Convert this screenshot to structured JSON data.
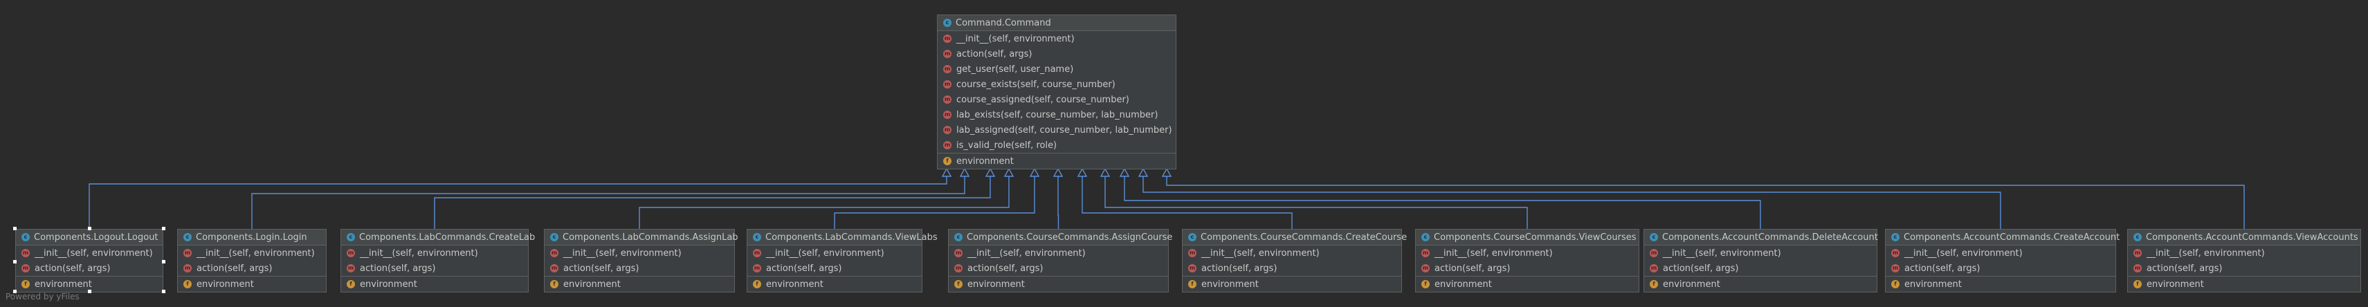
{
  "parent": {
    "name": "Command.Command",
    "icon": "class-icon",
    "methods": [
      "__init__(self, environment)",
      "action(self, args)",
      "get_user(self, user_name)",
      "course_exists(self, course_number)",
      "course_assigned(self, course_number)",
      "lab_exists(self, course_number, lab_number)",
      "lab_assigned(self, course_number, lab_number)",
      "is_valid_role(self, role)"
    ],
    "fields": [
      "environment"
    ]
  },
  "children": [
    {
      "name": "Components.Logout.Logout",
      "methods": [
        "__init__(self, environment)",
        "action(self, args)"
      ],
      "fields": [
        "environment"
      ]
    },
    {
      "name": "Components.Login.Login",
      "methods": [
        "__init__(self, environment)",
        "action(self, args)"
      ],
      "fields": [
        "environment"
      ]
    },
    {
      "name": "Components.LabCommands.CreateLab",
      "methods": [
        "__init__(self, environment)",
        "action(self, args)"
      ],
      "fields": [
        "environment"
      ]
    },
    {
      "name": "Components.LabCommands.AssignLab",
      "methods": [
        "__init__(self, environment)",
        "action(self, args)"
      ],
      "fields": [
        "environment"
      ]
    },
    {
      "name": "Components.LabCommands.ViewLabs",
      "methods": [
        "__init__(self, environment)",
        "action(self, args)"
      ],
      "fields": [
        "environment"
      ]
    },
    {
      "name": "Components.CourseCommands.AssignCourse",
      "methods": [
        "__init__(self, environment)",
        "action(self, args)"
      ],
      "fields": [
        "environment"
      ]
    },
    {
      "name": "Components.CourseCommands.CreateCourse",
      "methods": [
        "__init__(self, environment)",
        "action(self, args)"
      ],
      "fields": [
        "environment"
      ]
    },
    {
      "name": "Components.CourseCommands.ViewCourses",
      "methods": [
        "__init__(self, environment)",
        "action(self, args)"
      ],
      "fields": [
        "environment"
      ]
    },
    {
      "name": "Components.AccountCommands.DeleteAccount",
      "methods": [
        "__init__(self, environment)",
        "action(self, args)"
      ],
      "fields": [
        "environment"
      ]
    },
    {
      "name": "Components.AccountCommands.CreateAccount",
      "methods": [
        "__init__(self, environment)",
        "action(self, args)"
      ],
      "fields": [
        "environment"
      ]
    },
    {
      "name": "Components.AccountCommands.ViewAccounts",
      "methods": [
        "__init__(self, environment)",
        "action(self, args)"
      ],
      "fields": [
        "environment"
      ]
    }
  ],
  "watermark": "Powered by yFiles",
  "colors": {
    "background": "#2b2b2b",
    "node_fill": "#3c3f41",
    "node_border": "#5e6062",
    "edge": "#5a8fd8",
    "class_icon": "#3d8fb5",
    "method_icon": "#b75a5a",
    "field_icon": "#c9943a"
  },
  "icons": {
    "class": "class-icon",
    "method": "method-icon",
    "field": "field-icon"
  }
}
